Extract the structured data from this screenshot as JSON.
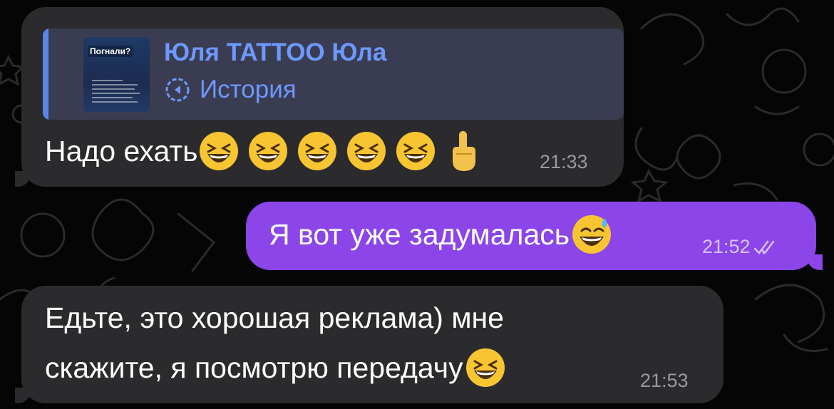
{
  "messages": [
    {
      "direction": "incoming",
      "reply": {
        "thumbnail_title": "Погнали?",
        "author": "Юля TATTOO Юла",
        "type_label": "История",
        "icon": "story-reply-icon"
      },
      "text": "Надо ехать",
      "emojis": [
        "grinning-squinting-face",
        "grinning-squinting-face",
        "grinning-squinting-face",
        "grinning-squinting-face",
        "grinning-squinting-face",
        "index-pointing-up"
      ],
      "time": "21:33"
    },
    {
      "direction": "outgoing",
      "text": "Я вот уже задумалась",
      "emojis": [
        "grinning-face-with-sweat"
      ],
      "time": "21:52",
      "status": "read-double-check"
    },
    {
      "direction": "incoming",
      "text_line1": "Едьте, это хорошая реклама) мне",
      "text_line2": "скажите, я посмотрю передачу",
      "emojis": [
        "grinning-squinting-face"
      ],
      "time": "21:53"
    }
  ],
  "colors": {
    "background": "#050505",
    "incoming_bubble": "#2b2b2e",
    "outgoing_bubble": "#8b45e8",
    "reply_block": "#3a3d52",
    "reply_accent": "#6d98ff"
  }
}
